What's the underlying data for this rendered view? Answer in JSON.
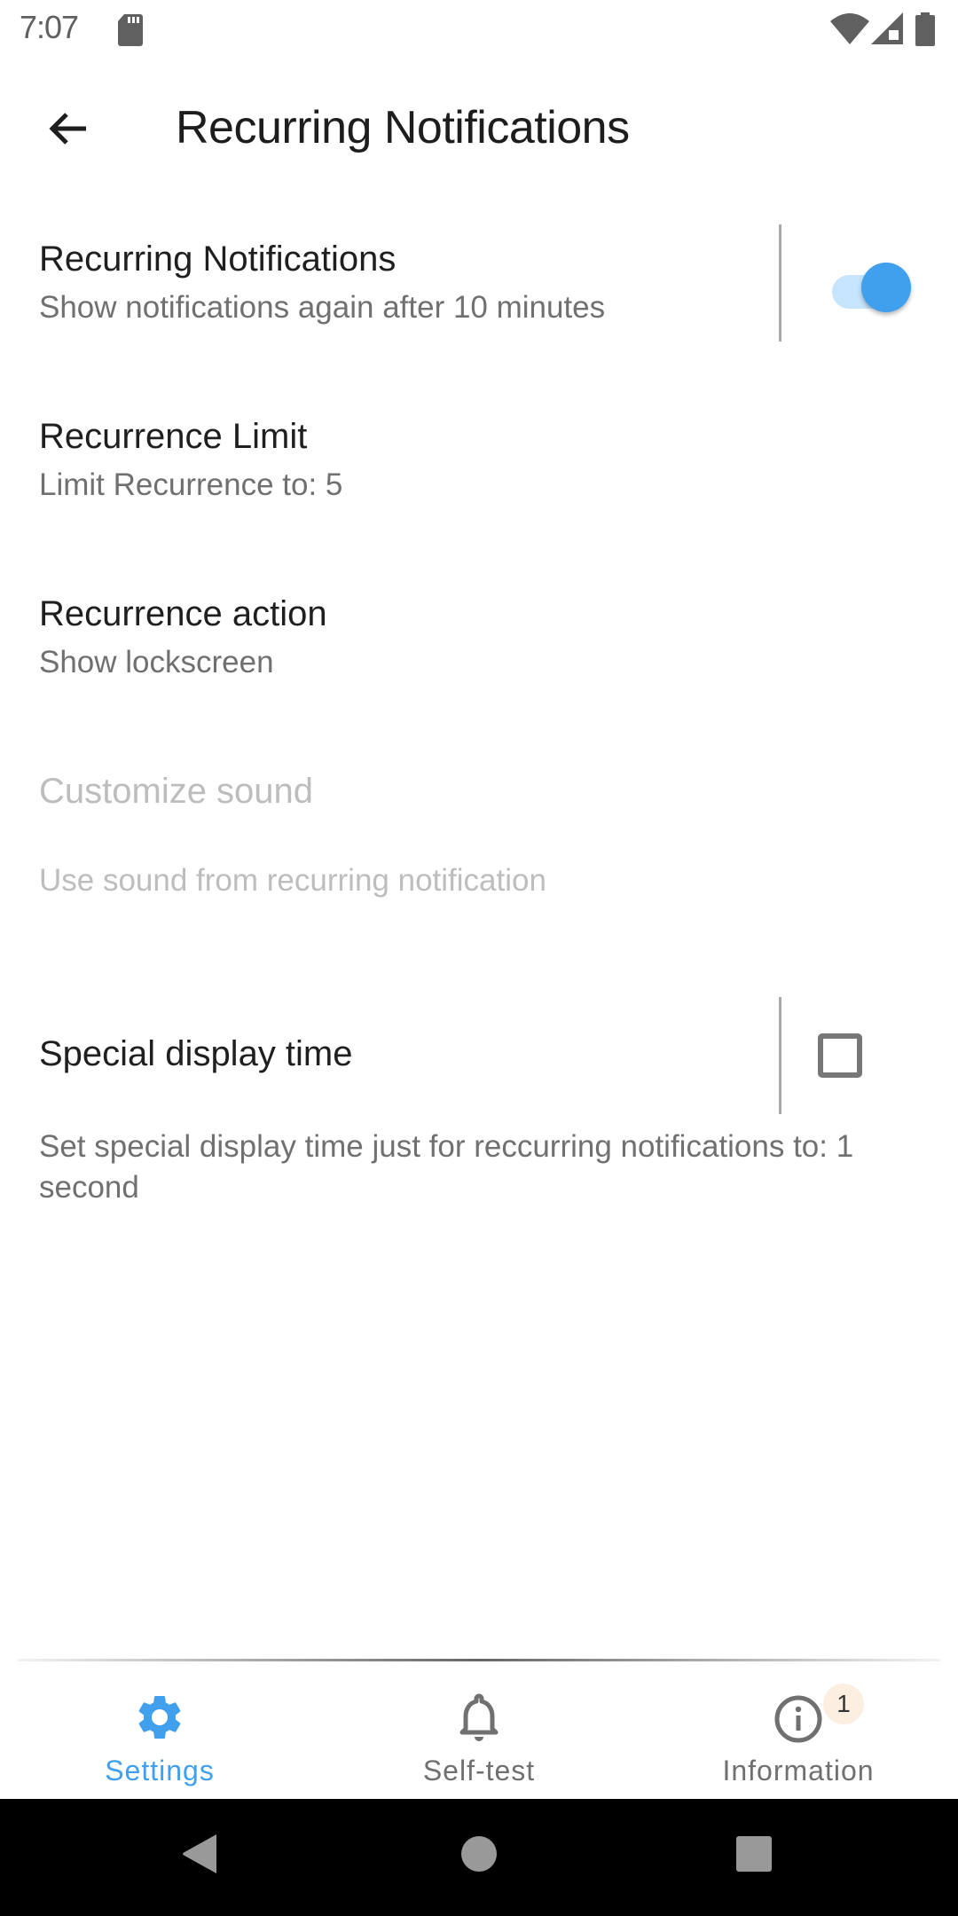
{
  "status_bar": {
    "time": "7:07",
    "icons": [
      "sd-card-icon",
      "wifi-icon",
      "signal-icon",
      "battery-icon"
    ]
  },
  "app_bar": {
    "back_icon": "arrow-left-icon",
    "title": "Recurring Notifications"
  },
  "preferences": [
    {
      "title": "Recurring Notifications",
      "summary": "Show notifications again after 10 minutes",
      "control": "switch",
      "checked": true,
      "enabled": true
    },
    {
      "title": "Recurrence Limit",
      "summary": "Limit Recurrence to: 5",
      "enabled": true
    },
    {
      "title": "Recurrence action",
      "summary": "Show lockscreen",
      "enabled": true
    },
    {
      "title": "Customize sound",
      "summary": "Use sound from recurring notification",
      "enabled": false
    },
    {
      "title": "Special display time",
      "summary": "Set special display time just for reccurring notifications to: 1 second",
      "control": "checkbox",
      "checked": false,
      "enabled": true
    }
  ],
  "bottom_nav": {
    "items": [
      {
        "label": "Settings",
        "icon": "gear-icon",
        "active": true
      },
      {
        "label": "Self-test",
        "icon": "bell-icon",
        "active": false
      },
      {
        "label": "Information",
        "icon": "info-icon",
        "active": false,
        "badge": "1"
      }
    ]
  },
  "colors": {
    "accent": "#41a0ee",
    "switch_track": "#c6e4fb",
    "text_primary": "#1f1f1f",
    "text_secondary": "#707070",
    "text_disabled": "#bdbdbd",
    "badge_bg": "#fdeee2"
  },
  "system_nav": {
    "buttons": [
      "back-triangle-icon",
      "home-circle-icon",
      "recents-square-icon"
    ]
  }
}
